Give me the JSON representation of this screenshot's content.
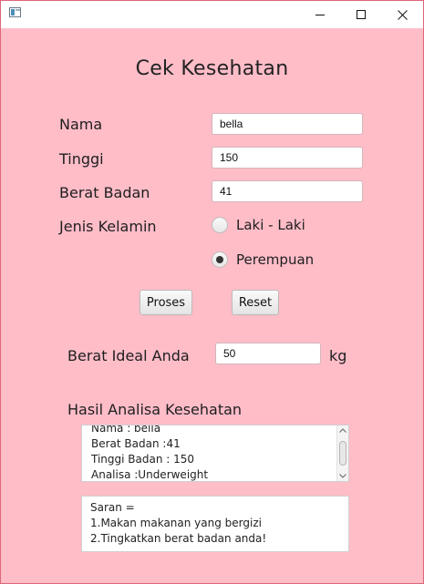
{
  "window": {
    "icons": {
      "app": "app-window-icon",
      "minimize": "minimize-icon",
      "maximize": "maximize-icon",
      "close": "close-icon"
    }
  },
  "form": {
    "title": "Cek Kesehatan",
    "nama_label": "Nama",
    "nama_value": "bella",
    "tinggi_label": "Tinggi",
    "tinggi_value": "150",
    "berat_label": "Berat Badan",
    "berat_value": "41",
    "jenis_label": "Jenis Kelamin",
    "gender_options": [
      {
        "label": "Laki - Laki",
        "selected": false
      },
      {
        "label": "Perempuan",
        "selected": true
      }
    ],
    "proses_label": "Proses",
    "reset_label": "Reset",
    "ideal_label": "Berat Ideal Anda",
    "ideal_value": "50",
    "ideal_unit": "kg",
    "hasil_label": "Hasil Analisa Kesehatan",
    "analysis_lines": [
      "Nama : bella",
      "Berat Badan :41",
      "Tinggi Badan : 150",
      "Analisa :Underweight"
    ],
    "saran_lines": [
      "Saran =",
      "1.Makan makanan yang bergizi",
      "2.Tingkatkan berat badan anda!"
    ]
  }
}
